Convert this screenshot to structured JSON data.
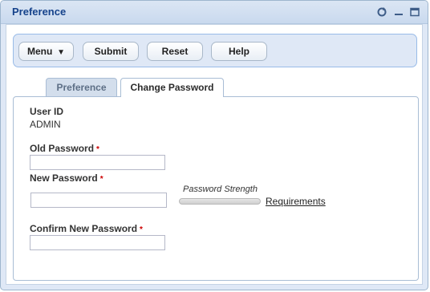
{
  "window": {
    "title": "Preference"
  },
  "toolbar": {
    "menu_label": "Menu",
    "submit_label": "Submit",
    "reset_label": "Reset",
    "help_label": "Help"
  },
  "tabs": [
    {
      "label": "Preference",
      "active": false
    },
    {
      "label": "Change Password",
      "active": true
    }
  ],
  "form": {
    "user_id_label": "User ID",
    "user_id_value": "ADMIN",
    "old_password_label": "Old Password",
    "new_password_label": "New Password",
    "confirm_password_label": "Confirm New Password",
    "required_marker": "*",
    "strength_label": "Password Strength",
    "requirements_link": "Requirements"
  },
  "icons": [
    "refresh-icon",
    "minimize-icon",
    "maximize-icon",
    "dropdown-arrow-icon"
  ],
  "colors": {
    "title_text": "#15428b",
    "required_marker": "#cc0000",
    "panel_bg": "#dfe8f6"
  }
}
